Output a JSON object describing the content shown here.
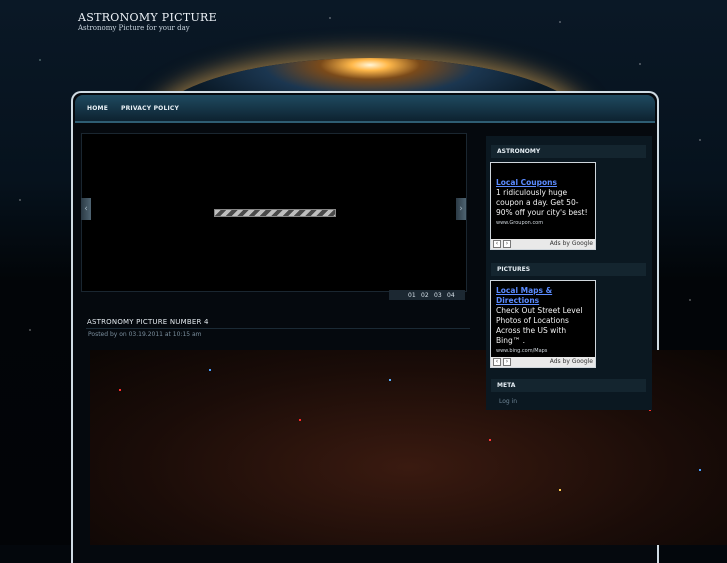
{
  "site": {
    "title": "ASTRONOMY PICTURE",
    "tagline": "Astronomy Picture for your day"
  },
  "nav": {
    "items": [
      "HOME",
      "PRIVACY POLICY"
    ]
  },
  "slider": {
    "pages": [
      "01",
      "02",
      "03",
      "04"
    ],
    "prev_glyph": "‹",
    "next_glyph": "›"
  },
  "post": {
    "title": "ASTRONOMY PICTURE NUMBER 4",
    "meta": "Posted by on 03.19.2011 at 10:15 am"
  },
  "sidebar": {
    "astronomy_title": "ASTRONOMY",
    "pictures_title": "PICTURES",
    "meta_title": "META",
    "meta_links": [
      "Log in"
    ],
    "ad1": {
      "link": "Local Coupons",
      "text": "1 ridiculously huge coupon a day. Get 50-90% off your city's best!",
      "url": "www.Groupon.com"
    },
    "ad2": {
      "link": "Local Maps & Directions",
      "text": "Check Out Street Level Photos of Locations Across the US with Bing™ .",
      "url": "www.bing.com/Maps"
    },
    "ads_by": "Ads by Google",
    "ad_prev": "‹",
    "ad_next": "›"
  },
  "colors": {
    "background": "#03070c",
    "frame_border": "#cfdbe3",
    "nav_bar": "#1f4a60",
    "ad_link": "#5b8bff"
  },
  "icons": [
    "slider-prev-arrow-icon",
    "slider-next-arrow-icon",
    "loading-bar-icon"
  ]
}
